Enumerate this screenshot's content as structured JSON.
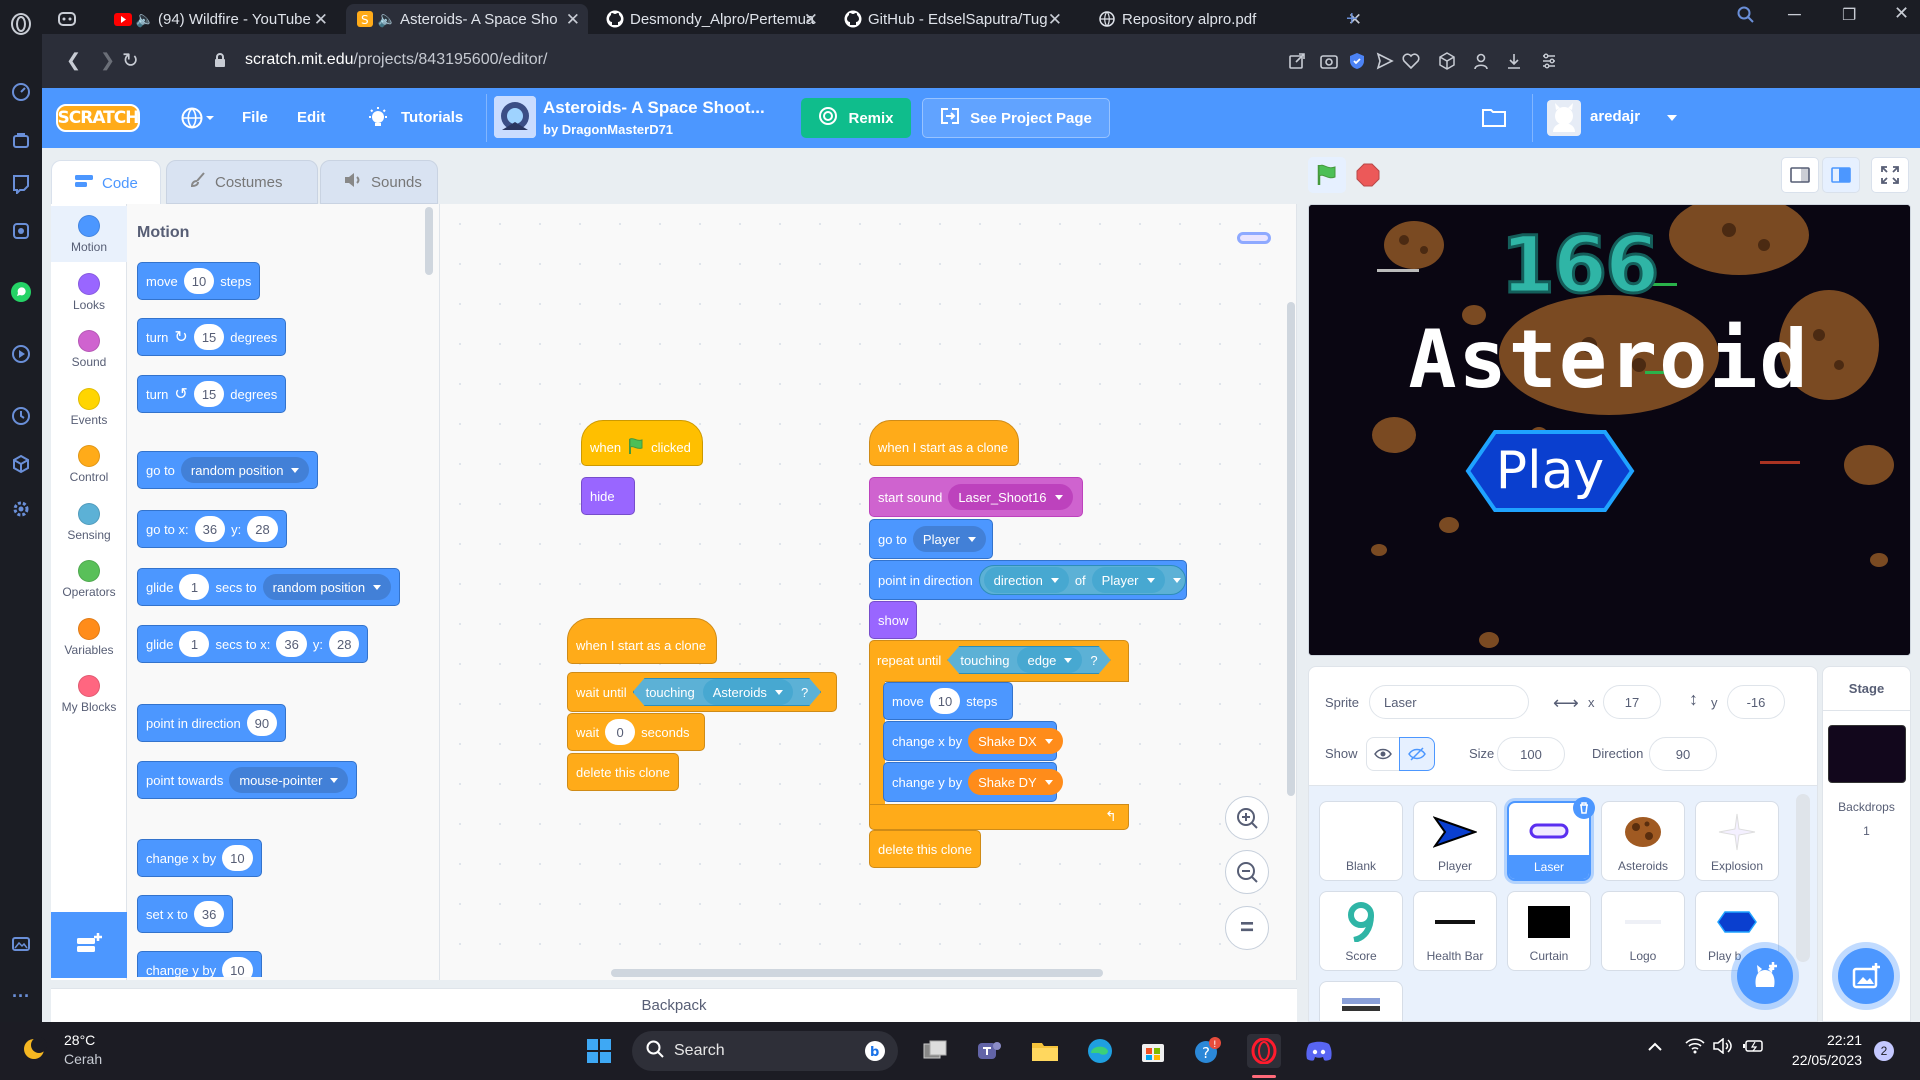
{
  "browser": {
    "tabs": [
      {
        "title": "(94) Wildfire - YouTube",
        "icon": "youtube-icon"
      },
      {
        "title": "Asteroids- A Space Sho",
        "icon": "scratch-icon"
      },
      {
        "title": "Desmondy_Alpro/Pertemua",
        "icon": "github-icon"
      },
      {
        "title": "GitHub - EdselSaputra/Tug",
        "icon": "github-icon"
      },
      {
        "title": "Repository alpro.pdf",
        "icon": "globe-icon"
      }
    ],
    "url_prefix": "scratch.mit.edu",
    "url_rest": "/projects/843195600/editor/"
  },
  "menu": {
    "logo": "SCRATCH",
    "file": "File",
    "edit": "Edit",
    "tutorials": "Tutorials",
    "project_title": "Asteroids- A Space Shoot...",
    "project_author": "by DragonMasterD71",
    "remix": "Remix",
    "see_project_page": "See Project Page",
    "username": "aredajr"
  },
  "editor_tabs": {
    "code": "Code",
    "costumes": "Costumes",
    "sounds": "Sounds"
  },
  "categories": [
    {
      "label": "Motion",
      "color": "#4c97ff"
    },
    {
      "label": "Looks",
      "color": "#9966ff"
    },
    {
      "label": "Sound",
      "color": "#cf63cf"
    },
    {
      "label": "Events",
      "color": "#ffd500"
    },
    {
      "label": "Control",
      "color": "#ffab19"
    },
    {
      "label": "Sensing",
      "color": "#5cb1d6"
    },
    {
      "label": "Operators",
      "color": "#59c059"
    },
    {
      "label": "Variables",
      "color": "#ff8c1a"
    },
    {
      "label": "My Blocks",
      "color": "#ff6680"
    }
  ],
  "palette": {
    "header": "Motion",
    "move": {
      "a": "move",
      "n": "10",
      "b": "steps"
    },
    "turn_right": {
      "a": "turn",
      "n": "15",
      "b": "degrees"
    },
    "turn_left": {
      "a": "turn",
      "n": "15",
      "b": "degrees"
    },
    "goto_random": {
      "a": "go to",
      "dd": "random position"
    },
    "goto_xy": {
      "a": "go to x:",
      "x": "36",
      "b": "y:",
      "y": "28"
    },
    "glide_random": {
      "a": "glide",
      "n": "1",
      "b": "secs to",
      "dd": "random position"
    },
    "glide_xy": {
      "a": "glide",
      "n": "1",
      "b": "secs to x:",
      "x": "36",
      "c": "y:",
      "y": "28"
    },
    "point_dir": {
      "a": "point in direction",
      "n": "90"
    },
    "point_towards": {
      "a": "point towards",
      "dd": "mouse-pointer"
    },
    "change_x": {
      "a": "change x by",
      "n": "10"
    },
    "set_x": {
      "a": "set x to",
      "n": "36"
    },
    "change_y": {
      "a": "change y by",
      "n": "10"
    }
  },
  "scripts": {
    "s1": {
      "hat_a": "when",
      "hat_b": "clicked",
      "hide": "hide"
    },
    "s2": {
      "hat": "when I start as a clone",
      "wait_until": "wait until",
      "touching": "touching",
      "touching_target": "Asteroids",
      "q": "?",
      "wait": "wait",
      "wait_n": "0",
      "seconds": "seconds",
      "delete": "delete this clone"
    },
    "s3": {
      "hat": "when I start as a clone",
      "start_sound": "start sound",
      "sound_name": "Laser_Shoot16",
      "goto": "go to",
      "goto_target": "Player",
      "point_dir": "point in direction",
      "dir_prop": "direction",
      "of": "of",
      "of_target": "Player",
      "show": "show",
      "repeat_until": "repeat until",
      "touching": "touching",
      "touching_target": "edge",
      "q": "?",
      "move": "move",
      "move_n": "10",
      "steps": "steps",
      "change_x": "change x by",
      "shake_dx": "Shake DX",
      "change_y": "change y by",
      "shake_dy": "Shake DY",
      "delete": "delete this clone"
    }
  },
  "backpack": "Backpack",
  "stage": {
    "score": "166",
    "title": "Asteroid",
    "play": "Play"
  },
  "sprite_info": {
    "sprite_label": "Sprite",
    "sprite_name": "Laser",
    "x_label": "x",
    "x": "17",
    "y_label": "y",
    "y": "-16",
    "show_label": "Show",
    "size_label": "Size",
    "size": "100",
    "direction_label": "Direction",
    "direction": "90"
  },
  "sprites": [
    {
      "name": "Blank"
    },
    {
      "name": "Player"
    },
    {
      "name": "Laser"
    },
    {
      "name": "Asteroids"
    },
    {
      "name": "Explosion"
    },
    {
      "name": "Score"
    },
    {
      "name": "Health Bar"
    },
    {
      "name": "Curtain"
    },
    {
      "name": "Logo"
    },
    {
      "name": "Play b"
    }
  ],
  "stage_panel": {
    "title": "Stage",
    "backdrops_label": "Backdrops",
    "backdrops_count": "1"
  },
  "taskbar": {
    "temp": "28°C",
    "weather": "Cerah",
    "search": "Search",
    "time": "22:21",
    "date": "22/05/2023",
    "notif_count": "2"
  }
}
